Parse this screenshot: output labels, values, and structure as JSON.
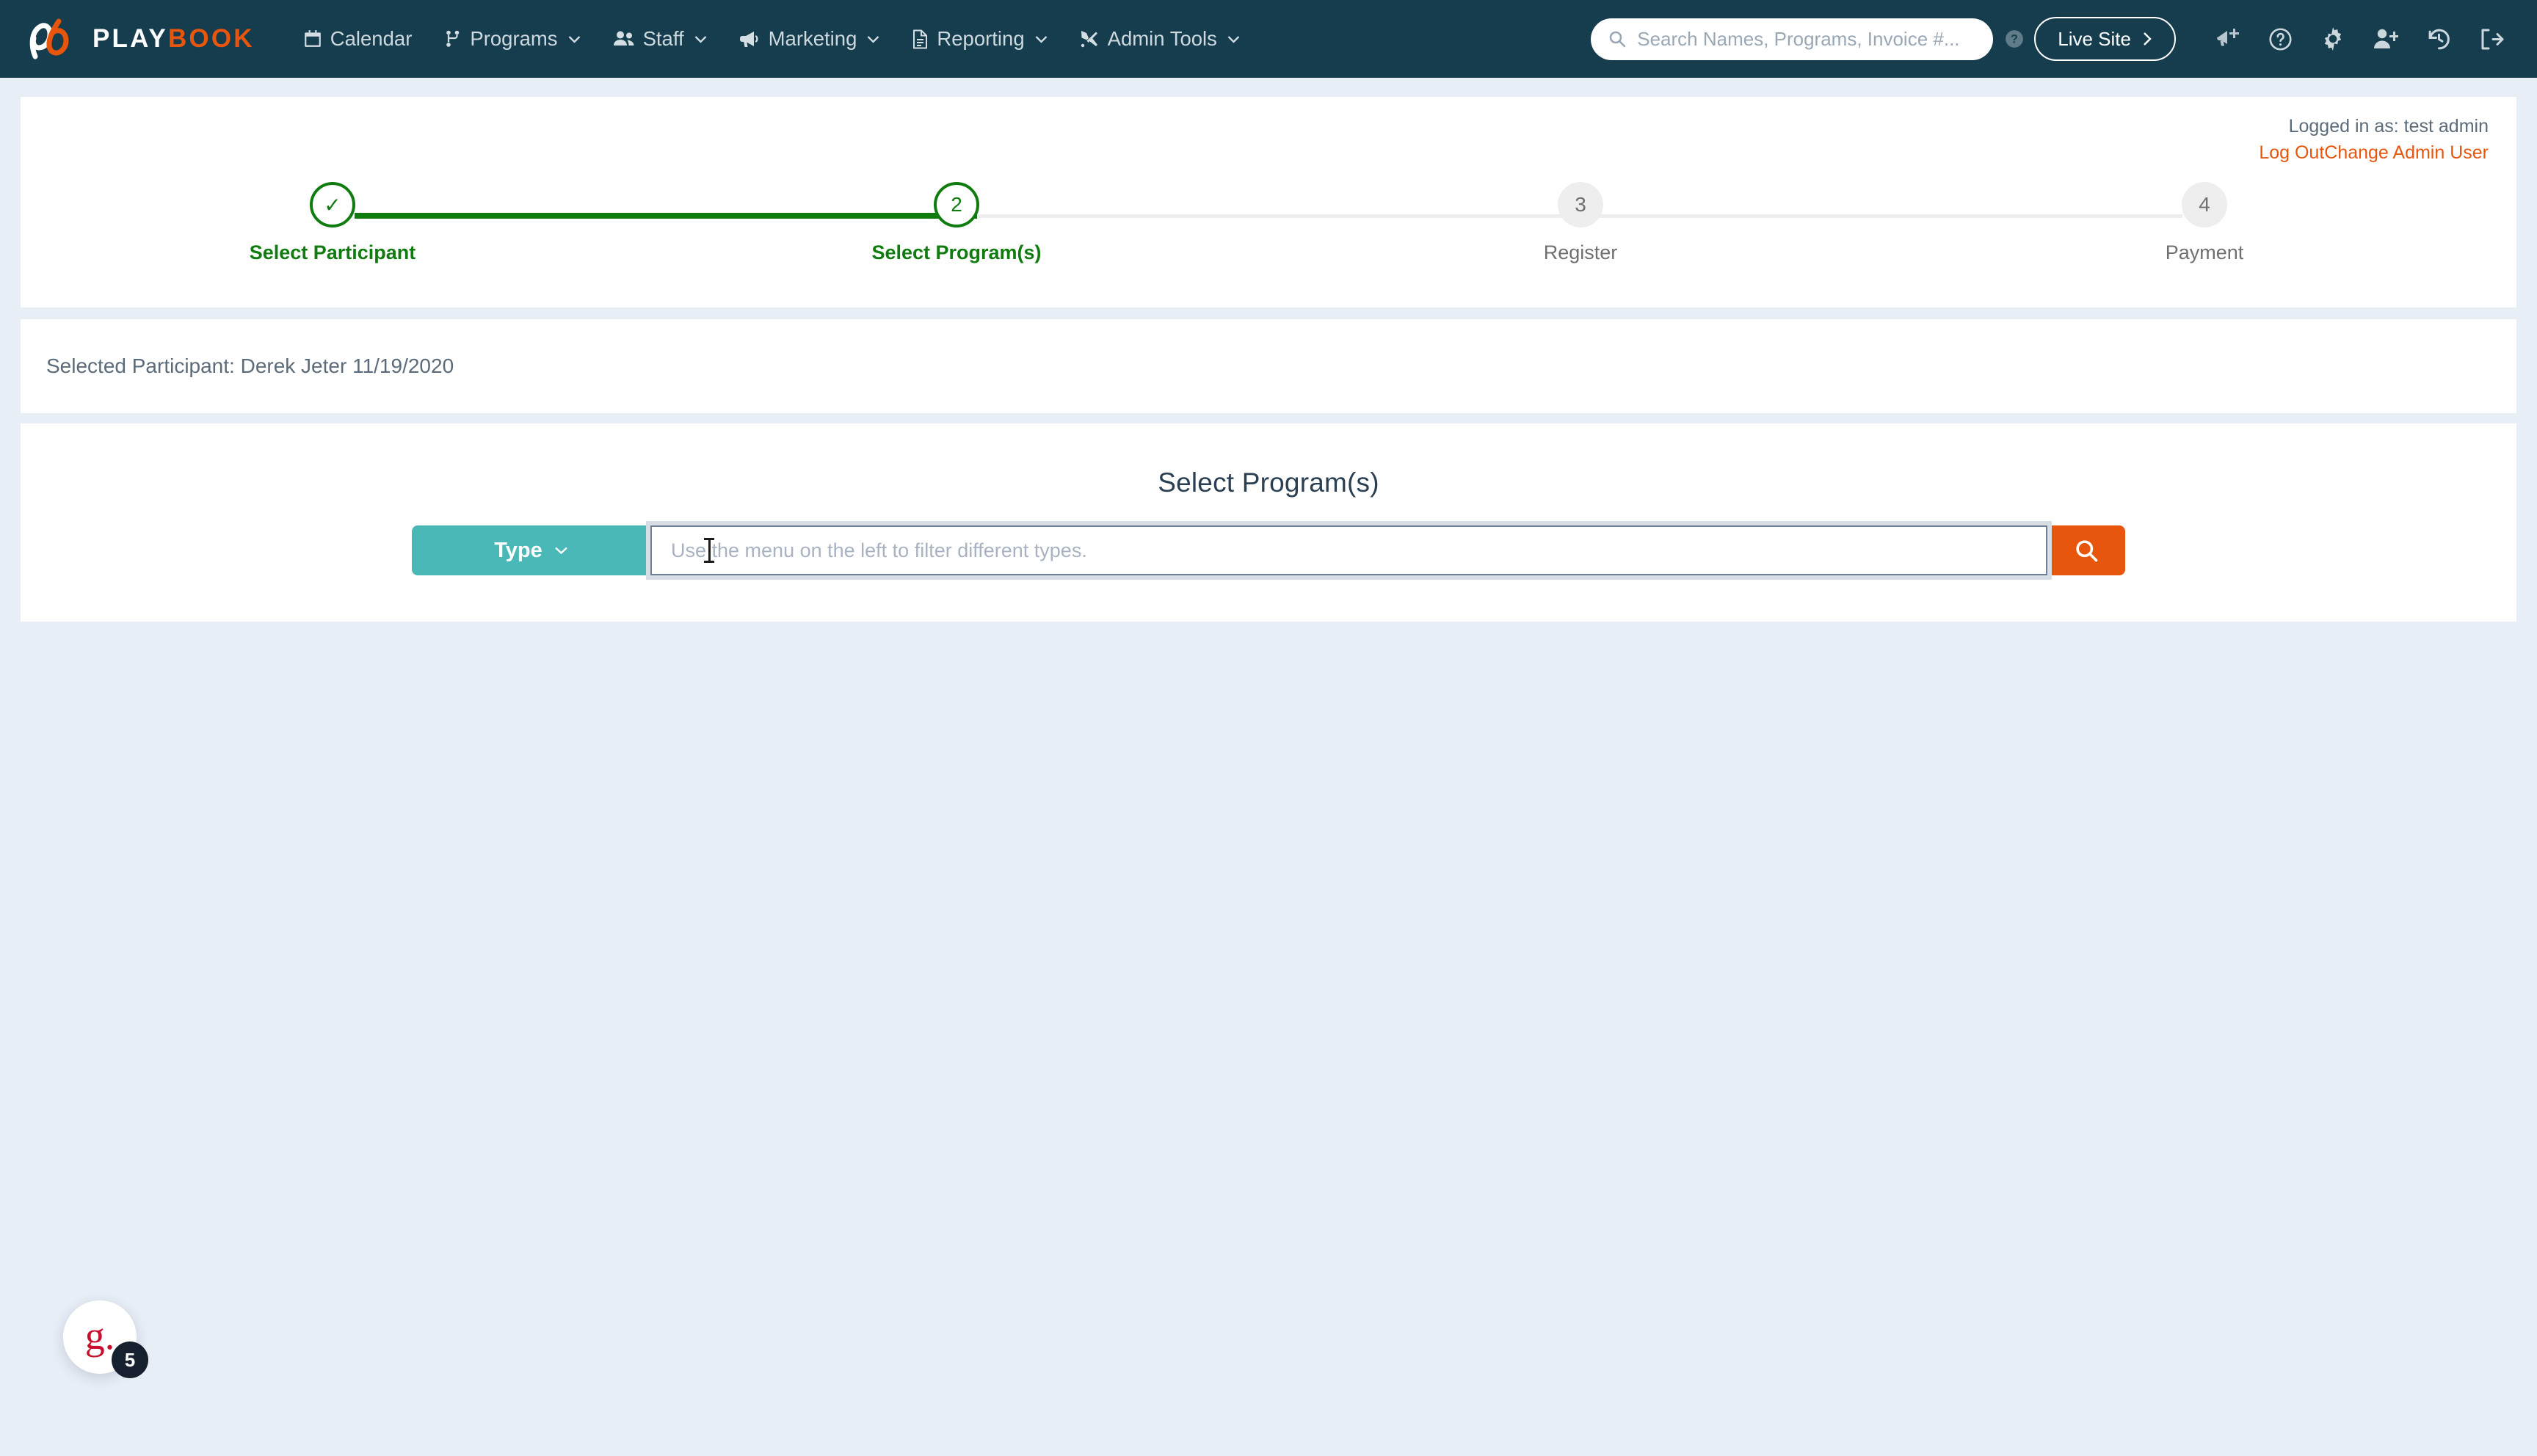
{
  "nav": {
    "brand": {
      "play": "PLAY",
      "book": "BOOK"
    },
    "links": [
      {
        "label": "Calendar",
        "icon": "calendar-icon",
        "caret": false
      },
      {
        "label": "Programs",
        "icon": "programs-icon",
        "caret": true
      },
      {
        "label": "Staff",
        "icon": "staff-icon",
        "caret": true
      },
      {
        "label": "Marketing",
        "icon": "megaphone-icon",
        "caret": true
      },
      {
        "label": "Reporting",
        "icon": "document-icon",
        "caret": true
      },
      {
        "label": "Admin Tools",
        "icon": "tools-icon",
        "caret": true
      }
    ],
    "search": {
      "placeholder": "Search Names, Programs, Invoice #...",
      "value": ""
    },
    "live_site": "Live Site",
    "icons": [
      "announcement-plus-icon",
      "help-circle-icon",
      "gear-icon",
      "add-user-icon",
      "history-icon",
      "logout-icon"
    ]
  },
  "account": {
    "logged_in_as": "Logged in as: test admin",
    "log_out": "Log Out",
    "change_admin_user": "Change Admin User"
  },
  "stepper": {
    "steps": [
      {
        "marker": "✓",
        "label": "Select Participant",
        "state": "done"
      },
      {
        "marker": "2",
        "label": "Select Program(s)",
        "state": "active"
      },
      {
        "marker": "3",
        "label": "Register",
        "state": "idle"
      },
      {
        "marker": "4",
        "label": "Payment",
        "state": "idle"
      }
    ]
  },
  "participant": {
    "text": "Selected Participant: Derek Jeter 11/19/2020"
  },
  "programs": {
    "title": "Select Program(s)",
    "type_button": "Type",
    "search_placeholder": "Use the menu on the left to filter different types.",
    "search_value": "",
    "search_button_icon": "search-icon"
  },
  "chat_widget": {
    "logo": "g.",
    "badge": "5"
  },
  "colors": {
    "nav_bg": "#153d4e",
    "page_bg": "#e8eef6",
    "orange": "#e8550d",
    "teal": "#4bb8b8",
    "green": "#107c10",
    "grey_step": "#6f6f6f",
    "badge_dark": "#17202e",
    "chat_red": "#c8102e"
  }
}
